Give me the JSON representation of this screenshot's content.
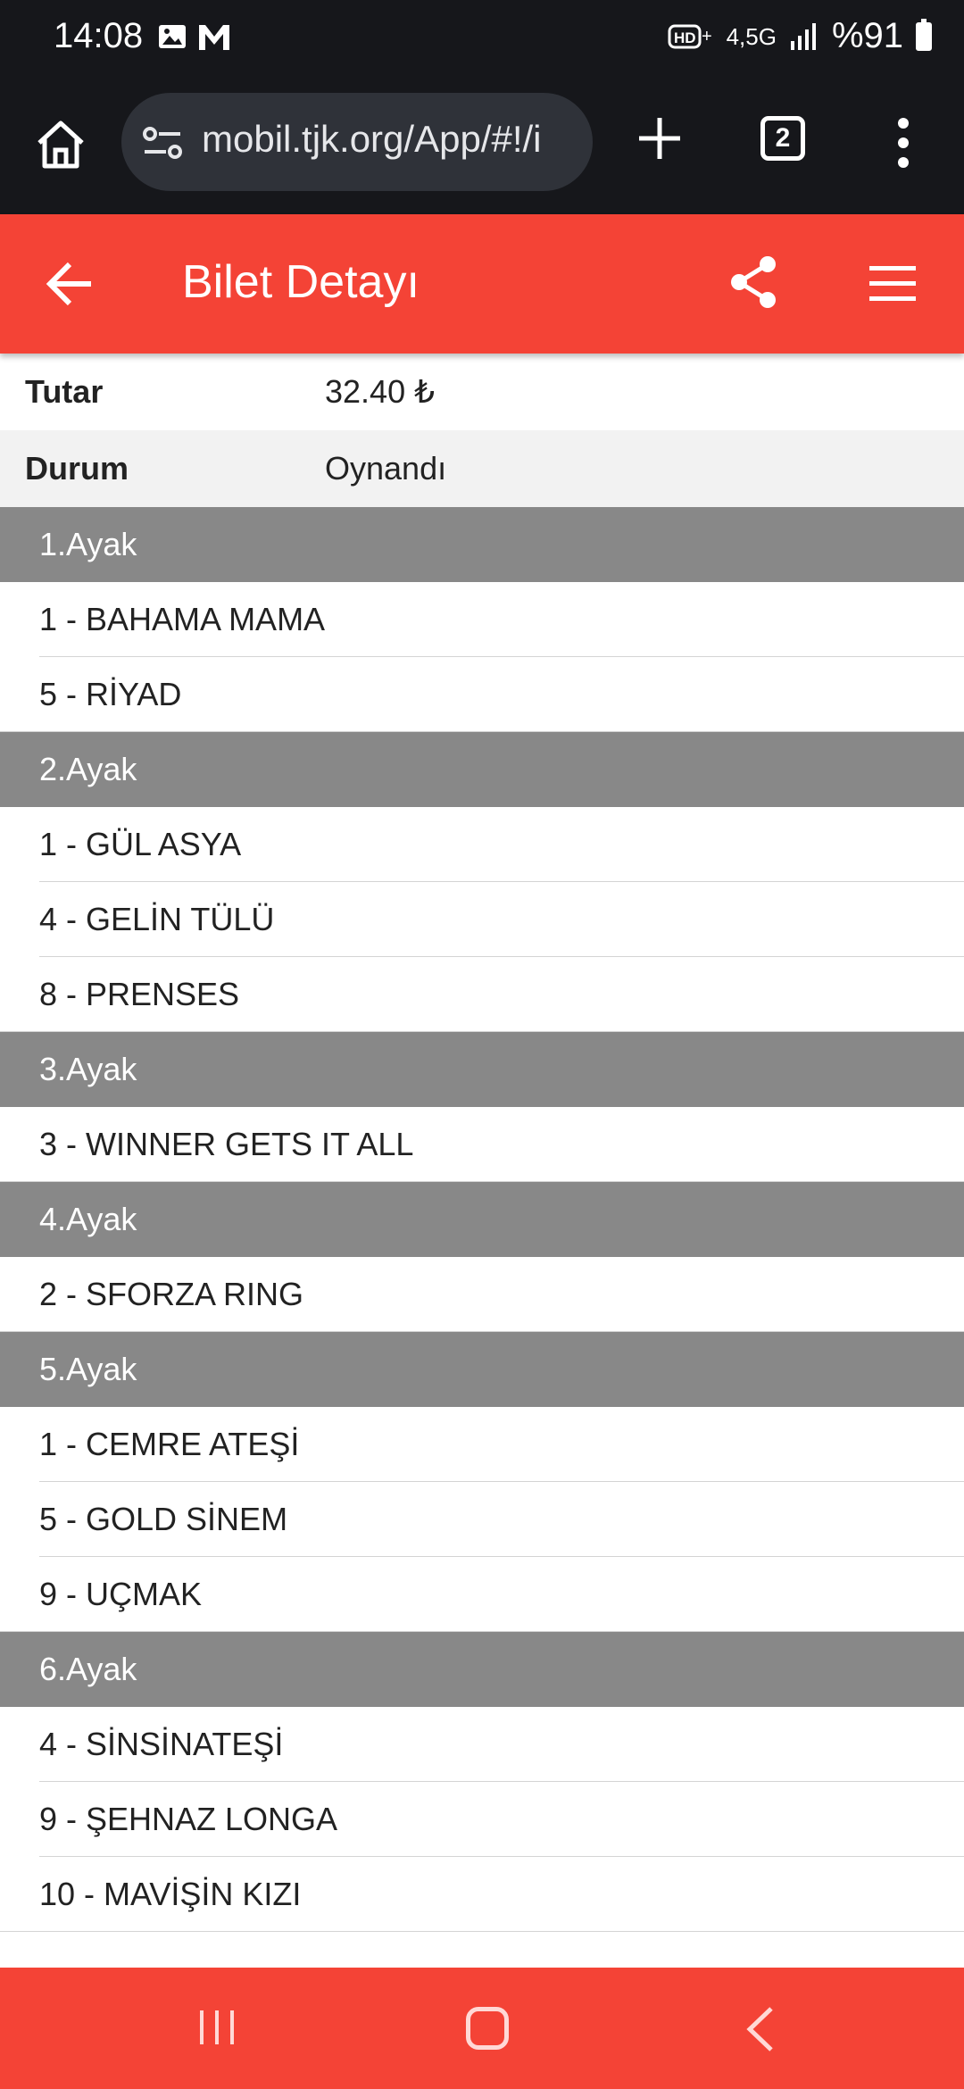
{
  "status_bar": {
    "time": "14:08",
    "network": "4,5G",
    "battery": "%91"
  },
  "browser": {
    "url": "mobil.tjk.org/App/#!/i",
    "tab_count": "2"
  },
  "header": {
    "title": "Bilet Detayı"
  },
  "info": [
    {
      "key": "Tutar",
      "value": "32.40 ₺"
    },
    {
      "key": "Durum",
      "value": "Oynandı"
    }
  ],
  "legs": [
    {
      "label": "1.Ayak",
      "horses": [
        "1 - BAHAMA MAMA",
        "5 - RİYAD"
      ]
    },
    {
      "label": "2.Ayak",
      "horses": [
        "1 - GÜL ASYA",
        "4 - GELİN TÜLÜ",
        "8 - PRENSES"
      ]
    },
    {
      "label": "3.Ayak",
      "horses": [
        "3 - WINNER GETS IT ALL"
      ]
    },
    {
      "label": "4.Ayak",
      "horses": [
        "2 - SFORZA RING"
      ]
    },
    {
      "label": "5.Ayak",
      "horses": [
        "1 - CEMRE ATEŞİ",
        "5 - GOLD SİNEM",
        "9 - UÇMAK"
      ]
    },
    {
      "label": "6.Ayak",
      "horses": [
        "4 - SİNSİNATEŞİ",
        "9 - ŞEHNAZ LONGA",
        "10 - MAVİŞİN KIZI"
      ]
    }
  ],
  "colors": {
    "accent": "#f44336",
    "leg_header": "#888888",
    "chrome": "#16171b"
  }
}
